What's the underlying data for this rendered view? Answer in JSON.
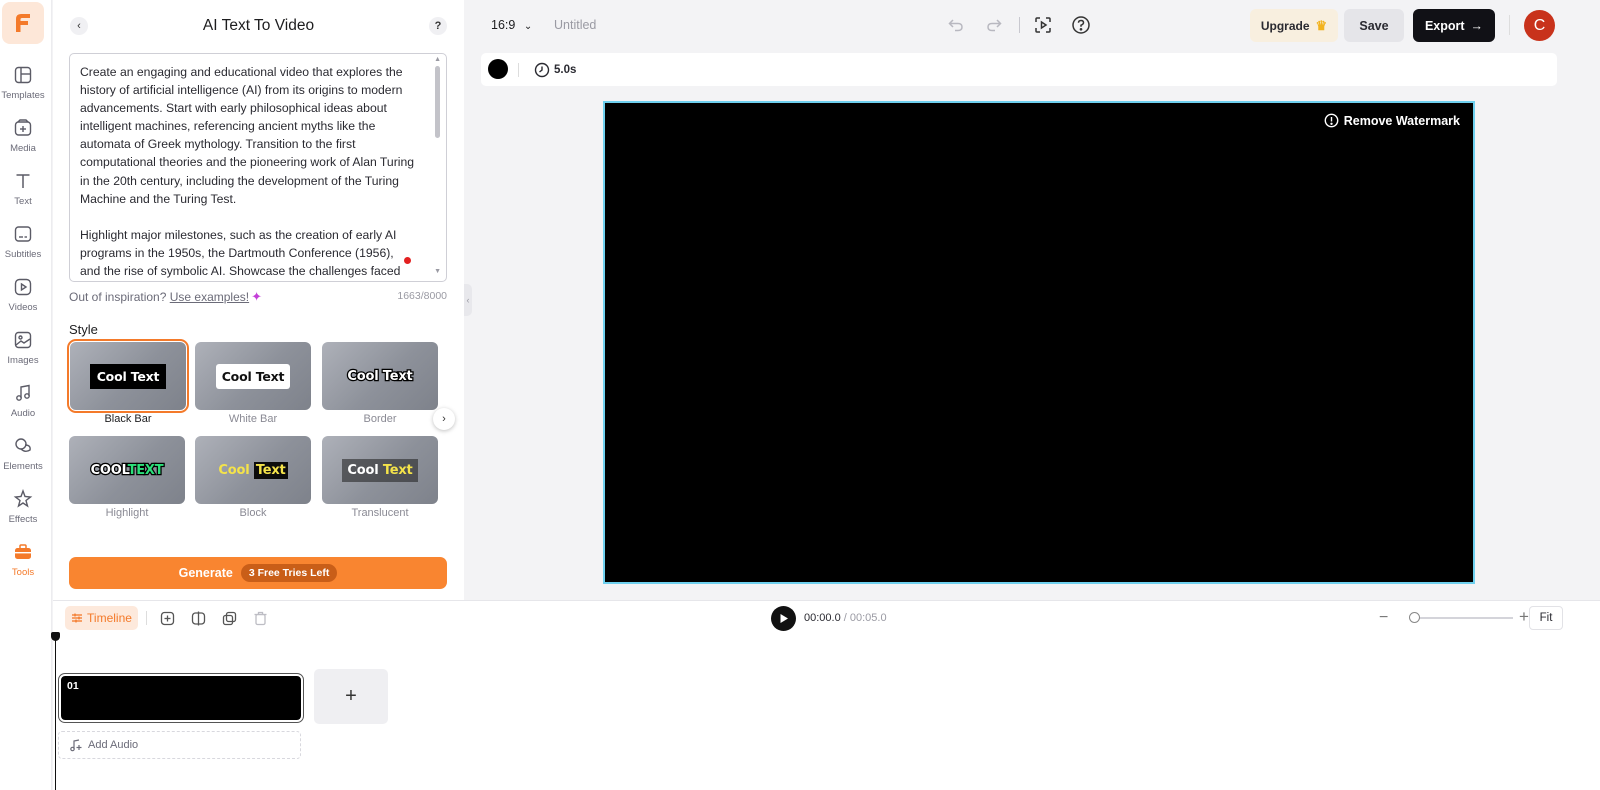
{
  "app": {
    "logo": "F"
  },
  "rail": {
    "items": [
      {
        "label": "Templates",
        "icon": "layout-icon"
      },
      {
        "label": "Media",
        "icon": "media-icon"
      },
      {
        "label": "Text",
        "icon": "text-icon"
      },
      {
        "label": "Subtitles",
        "icon": "subtitles-icon"
      },
      {
        "label": "Videos",
        "icon": "video-icon"
      },
      {
        "label": "Images",
        "icon": "image-icon"
      },
      {
        "label": "Audio",
        "icon": "music-icon"
      },
      {
        "label": "Elements",
        "icon": "shapes-icon"
      },
      {
        "label": "Effects",
        "icon": "sparkle-icon"
      },
      {
        "label": "Tools",
        "icon": "toolbox-icon",
        "active": true
      }
    ]
  },
  "panel": {
    "title": "AI Text To Video",
    "prompt": "Create an engaging and educational video that explores the history of artificial intelligence (AI) from its origins to modern advancements. Start with early philosophical ideas about intelligent machines, referencing ancient myths like the automata of Greek mythology. Transition to the first computational theories and the pioneering work of Alan Turing in the 20th century, including the development of the Turing Machine and the Turing Test.\n\nHighlight major milestones, such as the creation of early AI programs in the 1950s, the Dartmouth Conference (1956), and the rise of symbolic AI. Showcase the challenges faced",
    "inspiration_text": "Out of inspiration?",
    "inspiration_link": "Use examples!",
    "char_count": "1663/8000",
    "style_label": "Style",
    "styles": [
      {
        "name": "Black Bar",
        "preview": "Cool Text",
        "selected": true
      },
      {
        "name": "White Bar",
        "preview": "Cool Text"
      },
      {
        "name": "Border",
        "preview": "Cool Text"
      },
      {
        "name": "Highlight",
        "preview_a": "COOL",
        "preview_b": "TEXT"
      },
      {
        "name": "Block",
        "preview_a": "Cool",
        "preview_b": "Text"
      },
      {
        "name": "Translucent",
        "preview_a": "Cool",
        "preview_b": "Text"
      }
    ],
    "generate_label": "Generate",
    "tries_badge": "3 Free Tries Left"
  },
  "topbar": {
    "aspect_ratio": "16:9",
    "project_title": "Untitled",
    "upgrade_label": "Upgrade",
    "save_label": "Save",
    "export_label": "Export",
    "avatar_initial": "C"
  },
  "properties": {
    "fill_color": "#000000",
    "duration": "5.0s"
  },
  "canvas": {
    "watermark_label": "Remove Watermark",
    "background": "#000000"
  },
  "timeline": {
    "tab_label": "Timeline",
    "current_time": "00:00.0",
    "total_time": "/ 00:05.0",
    "zoom_level": 0.0,
    "fit_label": "Fit",
    "clip_number": "01",
    "add_scene_label": "+",
    "add_audio_label": "Add Audio"
  },
  "colors": {
    "accent": "#f98530",
    "selection_outline": "#6fd0ee"
  }
}
